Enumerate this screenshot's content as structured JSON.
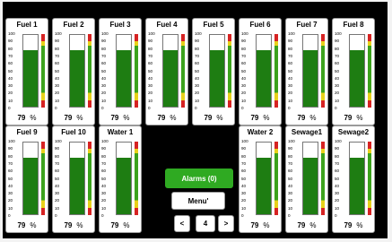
{
  "scale_ticks": [
    "100",
    "90",
    "80",
    "70",
    "60",
    "50",
    "40",
    "30",
    "20",
    "10",
    "0"
  ],
  "level_colors": {
    "fill": "#1e7d12",
    "high_alarm": "#d62323",
    "warning": "#e8d11a",
    "normal": "#3ca21d"
  },
  "tanks": [
    {
      "name": "Fuel 1",
      "level_pct": 79,
      "value": "79",
      "unit": "%"
    },
    {
      "name": "Fuel 2",
      "level_pct": 79,
      "value": "79",
      "unit": "%"
    },
    {
      "name": "Fuel 3",
      "level_pct": 79,
      "value": "79",
      "unit": "%"
    },
    {
      "name": "Fuel 4",
      "level_pct": 79,
      "value": "79",
      "unit": "%"
    },
    {
      "name": "Fuel 5",
      "level_pct": 79,
      "value": "79",
      "unit": "%"
    },
    {
      "name": "Fuel 6",
      "level_pct": 79,
      "value": "79",
      "unit": "%"
    },
    {
      "name": "Fuel 7",
      "level_pct": 79,
      "value": "79",
      "unit": "%"
    },
    {
      "name": "Fuel 8",
      "level_pct": 79,
      "value": "79",
      "unit": "%"
    },
    {
      "name": "Fuel 9",
      "level_pct": 79,
      "value": "79",
      "unit": "%"
    },
    {
      "name": "Fuel 10",
      "level_pct": 79,
      "value": "79",
      "unit": "%"
    },
    {
      "name": "Water 1",
      "level_pct": 79,
      "value": "79",
      "unit": "%"
    },
    {
      "name": "Water 2",
      "level_pct": 79,
      "value": "79",
      "unit": "%"
    },
    {
      "name": "Sewage1",
      "level_pct": 79,
      "value": "79",
      "unit": "%"
    },
    {
      "name": "Sewage2",
      "level_pct": 79,
      "value": "79",
      "unit": "%"
    }
  ],
  "controls": {
    "alarms_label": "Alarms (0)",
    "menu_label": "Menu'",
    "prev_label": "<",
    "page": "4",
    "next_label": ">"
  }
}
